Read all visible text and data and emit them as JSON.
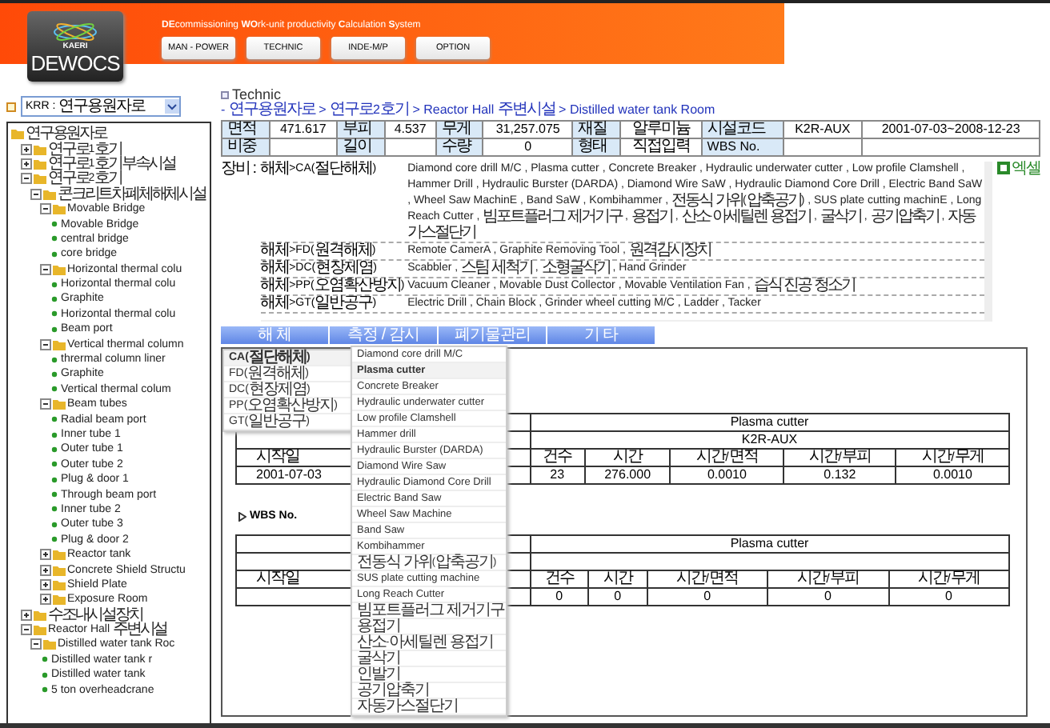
{
  "header": {
    "logo_small": "KAERI",
    "logo": "DEWOCS",
    "subtitle": "**DE**commissioning  **WO**rk-unit productivity  **C**alculation **S**ystem",
    "buttons": [
      "MAN - POWER",
      "TECHNIC",
      "INDE-M/P",
      "OPTION"
    ]
  },
  "sidebar": {
    "select": "KRR : 연구용원자로",
    "tree": [
      {
        "label": "연구용원자로",
        "kind": "folder",
        "children": [
          {
            "label": "연구로1호기",
            "kind": "folder",
            "expanded": false
          },
          {
            "label": "연구로1호기부속시설",
            "kind": "folder",
            "expanded": false
          },
          {
            "label": "연구로2호기",
            "kind": "folder",
            "expanded": true,
            "children": [
              {
                "label": "콘크리트차폐체해체시설",
                "kind": "folder",
                "expanded": true,
                "children": [
                  {
                    "label": "Movable Bridge",
                    "kind": "folder",
                    "expanded": true,
                    "children": [
                      {
                        "label": "Movable Bridge",
                        "kind": "leaf"
                      },
                      {
                        "label": "central bridge",
                        "kind": "leaf"
                      },
                      {
                        "label": "core bridge",
                        "kind": "leaf"
                      }
                    ]
                  },
                  {
                    "label": "Horizontal thermal colu",
                    "kind": "folder",
                    "expanded": true,
                    "children": [
                      {
                        "label": "Horizontal thermal colu",
                        "kind": "leaf"
                      },
                      {
                        "label": "Graphite",
                        "kind": "leaf"
                      },
                      {
                        "label": "Horizontal thermal colu",
                        "kind": "leaf"
                      },
                      {
                        "label": "Beam port",
                        "kind": "leaf"
                      }
                    ]
                  },
                  {
                    "label": "Vertical thermal column",
                    "kind": "folder",
                    "expanded": true,
                    "children": [
                      {
                        "label": "thrermal column liner",
                        "kind": "leaf"
                      },
                      {
                        "label": "Graphite",
                        "kind": "leaf"
                      },
                      {
                        "label": "Vertical thermal colum",
                        "kind": "leaf"
                      }
                    ]
                  },
                  {
                    "label": "Beam tubes",
                    "kind": "folder",
                    "expanded": true,
                    "children": [
                      {
                        "label": "Radial beam port",
                        "kind": "leaf"
                      },
                      {
                        "label": "Inner tube 1",
                        "kind": "leaf"
                      },
                      {
                        "label": "Outer tube 1",
                        "kind": "leaf"
                      },
                      {
                        "label": "Outer tube 2",
                        "kind": "leaf"
                      },
                      {
                        "label": "Plug & door 1",
                        "kind": "leaf"
                      },
                      {
                        "label": "Through beam port",
                        "kind": "leaf"
                      },
                      {
                        "label": "Inner tube 2",
                        "kind": "leaf"
                      },
                      {
                        "label": "Outer tube 3",
                        "kind": "leaf"
                      },
                      {
                        "label": "Plug & door 2",
                        "kind": "leaf"
                      }
                    ]
                  },
                  {
                    "label": "Reactor tank",
                    "kind": "folder",
                    "expanded": false
                  },
                  {
                    "label": "Concrete Shield Structu",
                    "kind": "folder",
                    "expanded": false
                  },
                  {
                    "label": "Shield Plate",
                    "kind": "folder",
                    "expanded": false
                  },
                  {
                    "label": "Exposure Room",
                    "kind": "folder",
                    "expanded": false
                  }
                ]
              }
            ]
          },
          {
            "label": "수조내시설장치",
            "kind": "folder",
            "expanded": false
          },
          {
            "label": "Reactor Hall 주변시설",
            "kind": "folder",
            "expanded": true,
            "children": [
              {
                "label": "Distilled water tank Roc",
                "kind": "folder",
                "expanded": true,
                "children": [
                  {
                    "label": "Distilled water tank r",
                    "kind": "leaf"
                  },
                  {
                    "label": "Distilled water tank",
                    "kind": "leaf"
                  },
                  {
                    "label": "5 ton overheadcrane",
                    "kind": "leaf"
                  }
                ]
              }
            ]
          }
        ]
      }
    ]
  },
  "main": {
    "title": "Technic",
    "breadcrumb": "- 연구용원자로 > 연구로2호기 > Reactor Hall 주변시설 > Distilled water tank Room",
    "info_rows": [
      [
        {
          "kind": "label",
          "text": "면적"
        },
        {
          "kind": "value",
          "text": "471.617"
        },
        {
          "kind": "label",
          "text": "부피"
        },
        {
          "kind": "value",
          "text": "4.537"
        },
        {
          "kind": "label",
          "text": "무게"
        },
        {
          "kind": "value",
          "text": "31,257.075"
        },
        {
          "kind": "label",
          "text": "재질"
        },
        {
          "kind": "value",
          "text": "알루미늄"
        },
        {
          "kind": "label",
          "text": "시설코드"
        },
        {
          "kind": "value",
          "text": "K2R-AUX"
        },
        {
          "kind": "value",
          "text": "2001-07-03~2008-12-23"
        }
      ],
      [
        {
          "kind": "label",
          "text": "비중"
        },
        {
          "kind": "blank"
        },
        {
          "kind": "label",
          "text": "길이"
        },
        {
          "kind": "blank"
        },
        {
          "kind": "label",
          "text": "수량"
        },
        {
          "kind": "value",
          "text": "0"
        },
        {
          "kind": "label",
          "text": "형태"
        },
        {
          "kind": "value",
          "text": "직접입력"
        },
        {
          "kind": "label",
          "text": "WBS No."
        },
        {
          "kind": "blank"
        },
        {
          "kind": "blank"
        }
      ]
    ],
    "equipment": {
      "label": "장비 :",
      "excel": "엑셀",
      "rows": [
        {
          "category": "해체>CA(절단해체)",
          "items": "Diamond core drill M/C , Plasma cutter , Concrete Breaker , Hydraulic underwater cutter , Low profile Clamshell , Hammer Drill , Hydraulic Burster (DARDA) , Diamond Wire SaW , Hydraulic Diamond Core Drill , Electric Band SaW , Wheel Saw MachinE , Band SaW , Kombihammer , 전동식 가위(압축공기) , SUS plate cutting machinE , Long Reach Cutter , 빔포트플러그 제거기구 , 용접기 , 산소-아세틸렌 용접기 , 굴삭기 , 공기압축기 , 자동가스절단기"
        },
        {
          "category": "해체>FD(원격해체)",
          "items": "Remote CamerA , Graphite Removing Tool , 원격감시장치"
        },
        {
          "category": "해체>DC(현장제염)",
          "items": "Scabbler , 스팀 세척기 , 소형굴삭기 , Hand Grinder"
        },
        {
          "category": "해체>PP(오염확산방지)",
          "items": "Vacuum Cleaner , Movable Dust Collector , Movable Ventilation Fan , 습식 진공 청소기"
        },
        {
          "category": "해체>GT(일반공구)",
          "items": "Electric Drill , Chain Block , Grinder wheel cutting M/C , Ladder , Tacker"
        }
      ]
    },
    "menu_tabs": [
      "해 체",
      "측정 / 감시",
      "폐기물관리",
      "기 타"
    ],
    "categories": [
      {
        "label": "CA(절단해체)",
        "selected": true
      },
      {
        "label": "FD(원격해체)",
        "selected": false
      },
      {
        "label": "DC(현장제염)",
        "selected": false
      },
      {
        "label": "PP(오염확산방지)",
        "selected": false
      },
      {
        "label": "GT(일반공구)",
        "selected": false
      }
    ],
    "tools": [
      {
        "label": "Diamond core drill M/C",
        "selected": false
      },
      {
        "label": "Plasma cutter",
        "selected": true
      },
      {
        "label": "Concrete Breaker",
        "selected": false
      },
      {
        "label": "Hydraulic underwater cutter",
        "selected": false
      },
      {
        "label": "Low profile Clamshell",
        "selected": false
      },
      {
        "label": "Hammer drill",
        "selected": false
      },
      {
        "label": "Hydraulic Burster (DARDA)",
        "selected": false
      },
      {
        "label": "Diamond Wire Saw",
        "selected": false
      },
      {
        "label": "Hydraulic Diamond Core Drill",
        "selected": false
      },
      {
        "label": "Electric Band Saw",
        "selected": false
      },
      {
        "label": "Wheel Saw Machine",
        "selected": false
      },
      {
        "label": "Band Saw",
        "selected": false
      },
      {
        "label": "Kombihammer",
        "selected": false
      },
      {
        "label": "전동식 가위(압축공기)",
        "selected": false
      },
      {
        "label": "SUS plate cutting machine",
        "selected": false
      },
      {
        "label": "Long Reach Cutter",
        "selected": false
      },
      {
        "label": "빔포트플러그 제거기구",
        "selected": false
      },
      {
        "label": "용접기",
        "selected": false
      },
      {
        "label": "산소-아세틸렌 용접기",
        "selected": false
      },
      {
        "label": "굴삭기",
        "selected": false
      },
      {
        "label": "인발기",
        "selected": false
      },
      {
        "label": "공기압축기",
        "selected": false
      },
      {
        "label": "자동가스절단기",
        "selected": false
      }
    ],
    "result_table": {
      "title": "Plasma cutter",
      "code": "K2R-AUX",
      "columns": [
        "시작일",
        "건수",
        "시간",
        "시간/면적",
        "시간/부피",
        "시간/무게"
      ],
      "start": "2001-07-03",
      "values": [
        "23",
        "276.000",
        "0.0010",
        "0.132",
        "0.0010"
      ]
    },
    "wbs_label": "WBS No.",
    "wbs_table": {
      "title": "Plasma cutter",
      "columns": [
        "시작일",
        "건수",
        "시간",
        "시간/면적",
        "시간/부피",
        "시간/무게"
      ],
      "values": [
        "0",
        "0",
        "0",
        "0",
        "0"
      ]
    }
  }
}
